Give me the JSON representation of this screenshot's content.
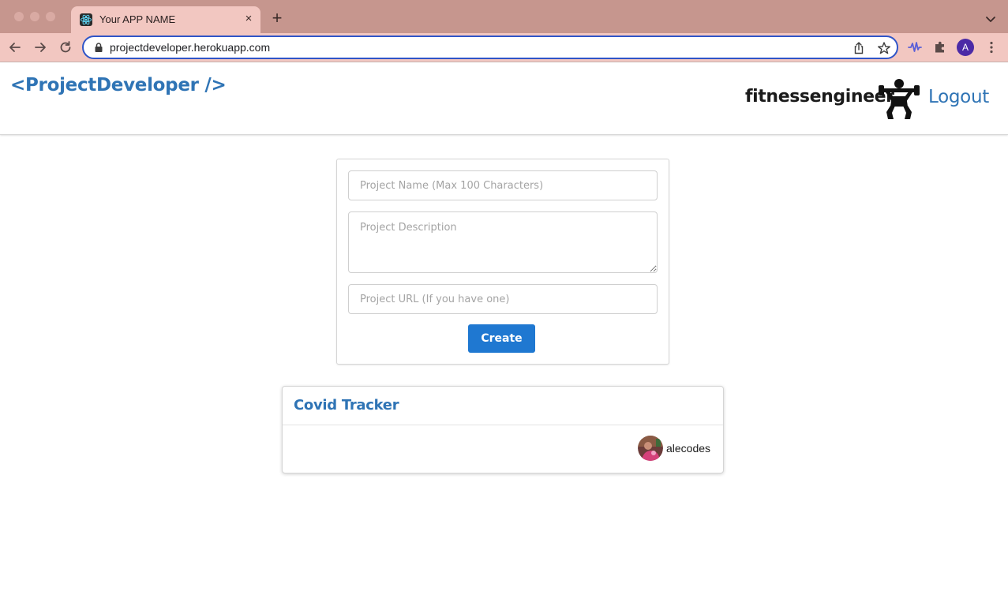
{
  "browser": {
    "tab_title": "Your APP NAME",
    "tab_close_label": "×",
    "new_tab_label": "+",
    "url": "projectdeveloper.herokuapp.com",
    "profile_initial": "A",
    "icons": [
      "react-favicon-icon",
      "back-icon",
      "forward-icon",
      "reload-icon",
      "lock-icon",
      "share-icon",
      "bookmark-star-icon",
      "extension-wave-icon",
      "puzzle-icon",
      "kebab-menu-icon",
      "chevron-down-icon"
    ]
  },
  "navbar": {
    "brand": "<ProjectDeveloper />",
    "username": "fitnessengineer",
    "avatar_icon": "weightlifter-icon",
    "logout_label": "Logout"
  },
  "form": {
    "name_placeholder": "Project Name (Max 100 Characters)",
    "description_placeholder": "Project Description",
    "url_placeholder": "Project URL (If you have one)",
    "create_label": "Create"
  },
  "projects": [
    {
      "title": "Covid Tracker",
      "author": "alecodes"
    }
  ],
  "colors": {
    "titlebar": "#c6968e",
    "toolbar": "#f2c7c1",
    "link_blue": "#2f74b5",
    "button_blue": "#1f78d1"
  }
}
